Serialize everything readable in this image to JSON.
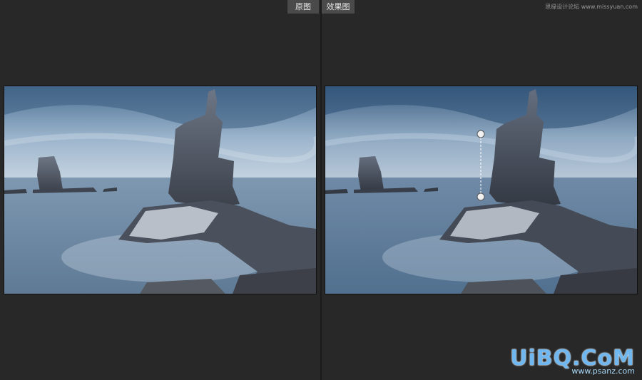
{
  "tabs": {
    "before_label": "原图",
    "after_label": "效果图"
  },
  "watermark_top": "思缘设计论坛 www.missyuan.com",
  "watermark_bottom": {
    "brand": "UiBQ.CoM",
    "site": "www.psanz.com"
  },
  "colors": {
    "background": "#282828",
    "tab_background": "#4a4a4a",
    "handle_line": "#ffffff"
  },
  "icons": {
    "adjust_handle": "circle-handle-icon"
  }
}
